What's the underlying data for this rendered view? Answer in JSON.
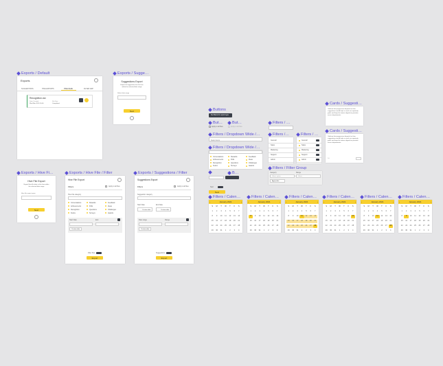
{
  "labels": {
    "exports_default": "Exports / Default",
    "exports_suggestions": "Exports / Sugge…",
    "exports_hive_file": "Exports / Hive Fi…",
    "exports_hive_filter": "Exports / Hive File / Filter",
    "exports_suggestions_filter": "Exports / Suggestions / Filter",
    "buttons": "Buttons",
    "but1": "But…",
    "but2": "But…",
    "filters_dropdown_wide_1": "Filters / Dropdown Wide /…",
    "filters_dropdown_wide_2": "Filters / Dropdown Wide /…",
    "filters_a": "Filters / …",
    "filters_b": "Filters /…",
    "filters_c": "Filters / …",
    "filter_group": "Filters / Filter Group",
    "b_small": "B…",
    "cards_suggestion_1": "Cards / Suggesti…",
    "cards_suggestion_2": "Cards / Suggesti…",
    "cal1": "Filters / Calen…",
    "cal2": "Filters / Calen…",
    "cal3": "Filters / Calen…",
    "cal4": "Filters / Calen…",
    "cal5": "Filters / Calen…",
    "cal6": "Filters / Calen…"
  },
  "exports_default": {
    "title": "Exports",
    "tabs": [
      "SUGGESTIONS",
      "HIVE EXPORTS",
      "HIVE FILES",
      "FILTER GRP"
    ],
    "card_title": "Recognition.csv",
    "card_meta1": "Date Created",
    "card_meta1_val": "Wed Mar 2020 10:00",
    "card_meta2": "File Size",
    "card_meta2_val": "Completed"
  },
  "suggestions_export": {
    "title": "Suggestions Export",
    "desc": "Export all suggestions for this hive within the selected date range",
    "field_label": "Select date range",
    "button": "Next"
  },
  "hive_export": {
    "title": "Hive File Export",
    "desc": "Export Hive file data in this hive within the selected date range",
    "field_label": "Hive file export name",
    "button": "Next"
  },
  "hive_filter": {
    "title": "Hive File Export",
    "filters_label": "Filters",
    "apply_label": "Apply to all files",
    "section": "Hive File category",
    "options": [
      "Conversations",
      "Rewards",
      "Feedback",
      "Achievements",
      "Polls",
      "Ideas",
      "Recognition",
      "Questions",
      "Challenges",
      "Kudos",
      "Surveys",
      "Awards"
    ],
    "date_label": "Start Date",
    "date_label2": "End",
    "range_text": "Custom date",
    "bottom_text": "Filter files",
    "button": "Export"
  },
  "sugg_filter": {
    "title": "Suggestions Export",
    "filters_label": "Filters",
    "apply_label": "Apply to all files",
    "section": "Suggestion category",
    "date_label": "Start Date",
    "date_label2": "End Date",
    "date_val": "Custom date",
    "range_label": "Date range",
    "range_label2": "Range",
    "range_text": "Custom date",
    "bottom_text": "Suggestions",
    "button": "Export"
  },
  "buttons": {
    "dark_btn": "Set filters for export type",
    "checkbox_label": "Apply to all files",
    "checkbox_label2": "Apply to all files",
    "small_btn": "Next",
    "yellow_btn": "Next"
  },
  "dropdown_wide": {
    "header": "Select items",
    "items": [
      "Conversations",
      "Rewards",
      "Feedback",
      "Achievements",
      "Polls",
      "Ideas",
      "Recognition",
      "Questions",
      "Challenges",
      "Kudos",
      "Surveys",
      "Awards"
    ]
  },
  "filter_list": {
    "items": [
      "General",
      "Sales",
      "Marketing",
      "Support",
      "Admin"
    ]
  },
  "filter_list2": {
    "items": [
      "General",
      "Sales",
      "Marketing",
      "Support",
      "Admin"
    ]
  },
  "filter_group": {
    "label1": "Category",
    "label2": "Range",
    "select1": "Select option",
    "select2": "Select",
    "apply": "Apply date"
  },
  "cards": {
    "text": "I believe that progressive dispatch on hive suggestions would help us reach our quarterly goals and keep the teams aligned on priorities across departments.",
    "meta": "2d"
  },
  "calendar": {
    "month": "January 2021",
    "days": [
      "S",
      "M",
      "T",
      "W",
      "T",
      "F",
      "S"
    ]
  },
  "colors": {
    "accent": "#f7cf2e",
    "label": "#5b4fd6",
    "dark": "#3a3f48"
  }
}
